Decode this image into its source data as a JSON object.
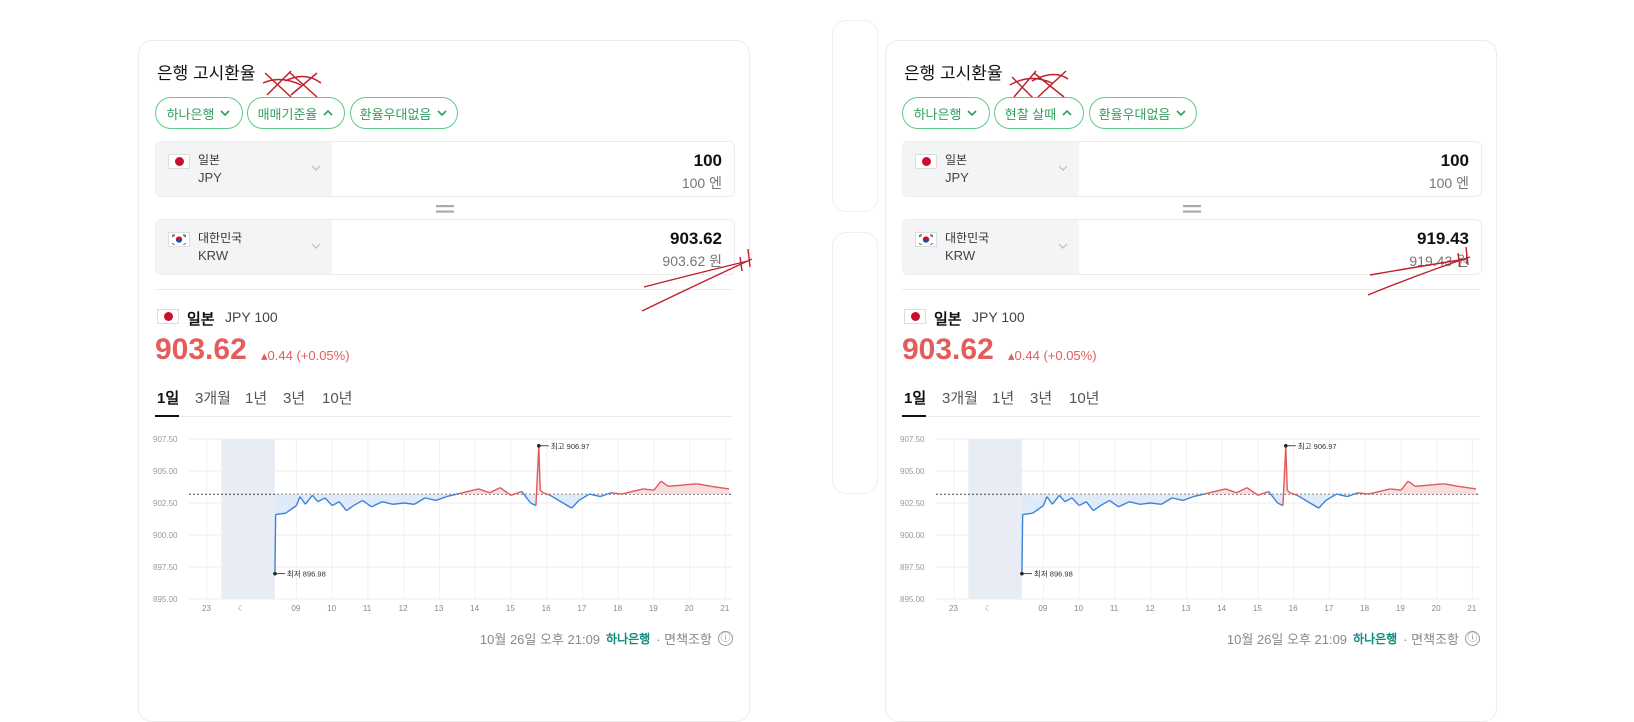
{
  "cards": [
    {
      "title": "은행 고시환율",
      "pills": [
        "하나은행",
        "매매기준율",
        "환율우대없음"
      ],
      "pill_chevrons": [
        "down",
        "up",
        "down"
      ],
      "from": {
        "name": "일본",
        "code": "JPY",
        "amount": "100",
        "amount_sub": "100 엔"
      },
      "to": {
        "name": "대한민국",
        "code": "KRW",
        "amount": "903.62",
        "amount_sub": "903.62 원"
      },
      "summary": {
        "name": "일본",
        "sub": "JPY 100",
        "price": "903.62",
        "change": "▴0.44 (+0.05%)"
      },
      "tabs": [
        "1일",
        "3개월",
        "1년",
        "3년",
        "10년"
      ],
      "active_tab": "1일",
      "footer": {
        "timestamp": "10월 26일 오후 21:09",
        "bank_logo": "하나은행",
        "disclaimer": "· 면책조항",
        "info_icon": "ⓘ"
      }
    },
    {
      "title": "은행 고시환율",
      "pills": [
        "하나은행",
        "현찰 살때",
        "환율우대없음"
      ],
      "pill_chevrons": [
        "down",
        "up",
        "down"
      ],
      "from": {
        "name": "일본",
        "code": "JPY",
        "amount": "100",
        "amount_sub": "100 엔"
      },
      "to": {
        "name": "대한민국",
        "code": "KRW",
        "amount": "919.43",
        "amount_sub": "919.43 원"
      },
      "summary": {
        "name": "일본",
        "sub": "JPY 100",
        "price": "903.62",
        "change": "▴0.44 (+0.05%)"
      },
      "tabs": [
        "1일",
        "3개월",
        "1년",
        "3년",
        "10년"
      ],
      "active_tab": "1일",
      "footer": {
        "timestamp": "10월 26일 오후 21:09",
        "bank_logo": "하나은행",
        "disclaimer": "· 면책조항",
        "info_icon": "ⓘ"
      }
    }
  ],
  "chart_data": {
    "type": "line",
    "yticks": [
      "907.50",
      "905.00",
      "902.50",
      "900.00",
      "897.50",
      "895.00"
    ],
    "ylim": [
      895.0,
      907.5
    ],
    "xticks": [
      "23",
      "☾",
      "09",
      "10",
      "11",
      "12",
      "13",
      "14",
      "15",
      "16",
      "17",
      "18",
      "19",
      "20",
      "21"
    ],
    "baseline": 903.18,
    "high_label": "최고 906.97",
    "low_label": "최저 896.98",
    "series": [
      {
        "x": [
          8.4,
          8.42,
          8.7,
          8.75,
          8.9,
          9.0,
          9.1,
          9.25,
          9.45,
          9.6,
          9.8,
          10.0,
          10.2,
          10.4,
          10.6,
          10.85,
          11.1,
          11.4,
          11.7,
          12.0,
          12.3,
          12.6,
          12.9,
          13.2,
          13.5,
          13.8,
          14.1,
          14.4,
          14.7,
          15.0,
          15.3,
          15.55,
          15.7,
          15.78,
          15.82,
          15.9,
          16.1,
          16.4,
          16.7,
          16.9,
          17.2,
          17.5,
          17.8,
          18.1,
          18.4,
          18.7,
          19.0,
          19.2,
          19.4,
          19.8,
          20.2,
          20.6,
          21.1
        ],
        "y": [
          896.98,
          901.6,
          901.7,
          901.8,
          902.1,
          902.3,
          903.0,
          902.4,
          903.1,
          902.6,
          902.9,
          902.3,
          902.6,
          901.9,
          902.3,
          902.7,
          902.2,
          902.6,
          902.4,
          902.5,
          902.4,
          902.9,
          902.7,
          903.0,
          903.2,
          903.4,
          903.6,
          903.3,
          903.7,
          903.1,
          903.4,
          902.5,
          902.3,
          906.97,
          903.5,
          903.3,
          903.1,
          902.6,
          902.1,
          902.7,
          903.2,
          903.0,
          903.3,
          903.2,
          903.4,
          903.6,
          903.5,
          904.2,
          903.8,
          903.9,
          904.0,
          903.8,
          903.6
        ]
      }
    ],
    "colors": {
      "up": "#e05a5a",
      "down": "#3b82d8",
      "up_fill": "#f6d6d6",
      "down_fill": "#d8e6f7",
      "night_shade": "#e8ecf4"
    }
  },
  "colors": {
    "accent_green": "#2e9e5b",
    "price_red": "#e55c5c",
    "marker_ink": "#c0202a"
  }
}
